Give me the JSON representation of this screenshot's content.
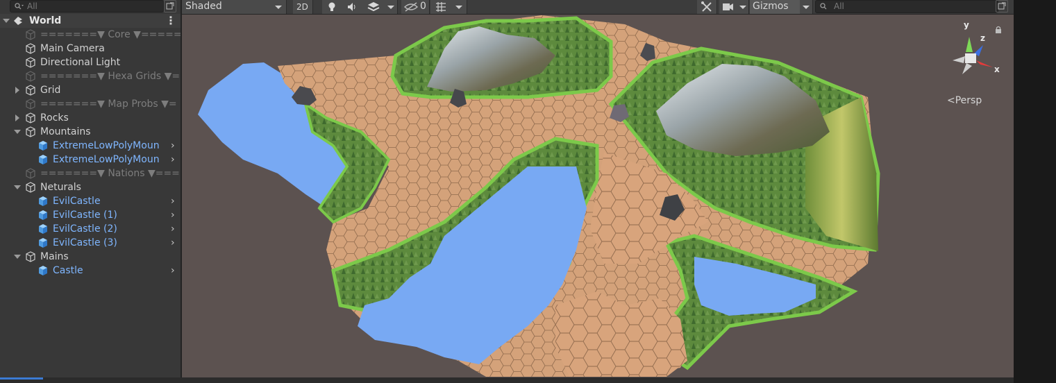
{
  "hierarchy": {
    "search_placeholder": "All",
    "scene": "World",
    "rows": [
      {
        "label": "=======▼ Core ▼=====",
        "kind": "sep"
      },
      {
        "label": "Main Camera",
        "kind": "obj"
      },
      {
        "label": "Directional Light",
        "kind": "obj"
      },
      {
        "label": "=======▼ Hexa Grids ▼=",
        "kind": "sep"
      },
      {
        "label": "Grid",
        "kind": "obj"
      },
      {
        "label": "=======▼ Map Probs ▼=",
        "kind": "sep"
      },
      {
        "label": "Rocks",
        "kind": "obj"
      },
      {
        "label": "Mountains",
        "kind": "obj"
      },
      {
        "label": "ExtremeLowPolyMoun",
        "kind": "prefab"
      },
      {
        "label": "ExtremeLowPolyMoun",
        "kind": "prefab"
      },
      {
        "label": "=======▼ Nations ▼===",
        "kind": "sep"
      },
      {
        "label": "Neturals",
        "kind": "obj"
      },
      {
        "label": "EvilCastle",
        "kind": "prefab"
      },
      {
        "label": "EvilCastle (1)",
        "kind": "prefab"
      },
      {
        "label": "EvilCastle (2)",
        "kind": "prefab"
      },
      {
        "label": "EvilCastle (3)",
        "kind": "prefab"
      },
      {
        "label": "Mains",
        "kind": "obj"
      },
      {
        "label": "Castle",
        "kind": "prefab"
      }
    ]
  },
  "scene_toolbar": {
    "draw_mode": "Shaded",
    "mode_2d": "2D",
    "hidden_count": "0",
    "gizmos": "Gizmos",
    "search_placeholder": "All"
  },
  "gizmo": {
    "axis_x": "x",
    "axis_y": "y",
    "axis_z": "z",
    "projection": "Persp"
  },
  "colors": {
    "prefab_text": "#7fb6ff",
    "water": "#78a9f3",
    "hex_tile": "#d4a27a",
    "grass_edge": "#7cc94a",
    "viewport_bg": "#5c5250"
  }
}
